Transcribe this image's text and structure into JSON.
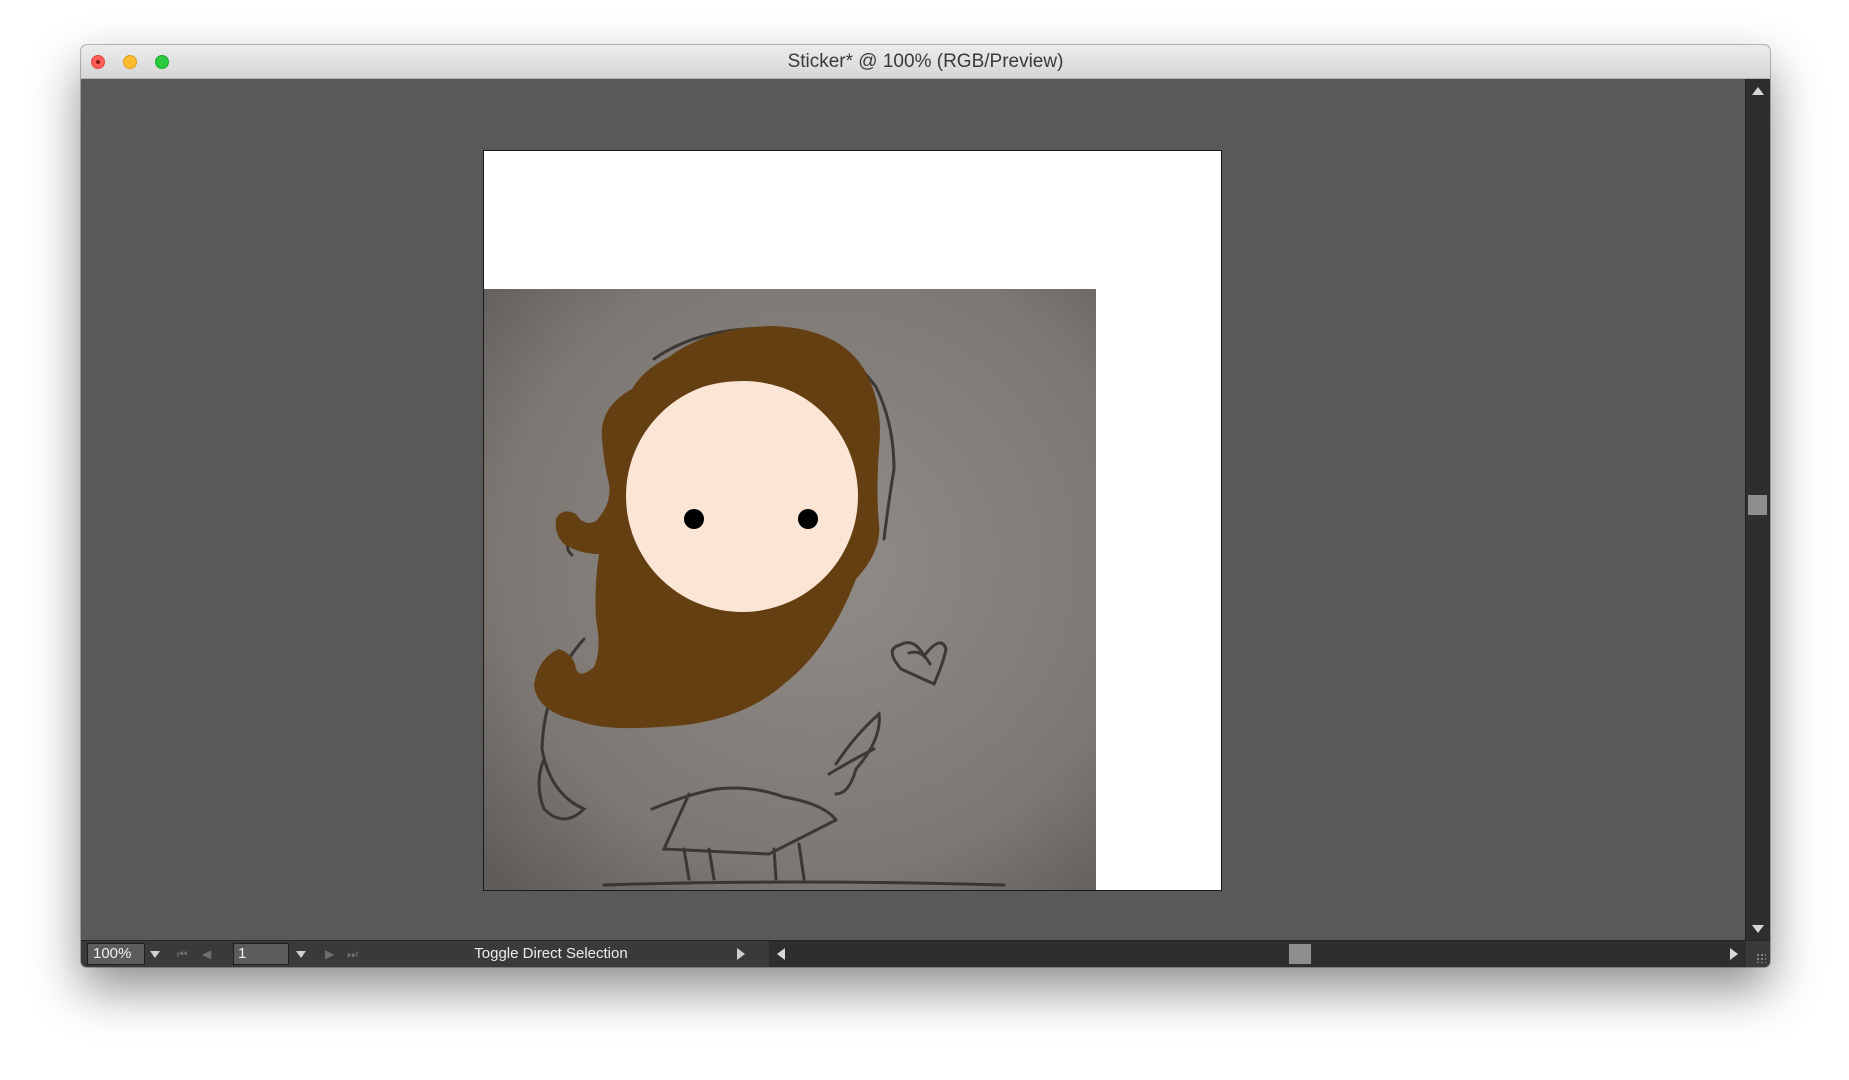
{
  "window": {
    "title": "Sticker* @ 100% (RGB/Preview)"
  },
  "statusbar": {
    "zoom": "100%",
    "page": "1",
    "status_text": "Toggle Direct Selection"
  },
  "icons": {
    "close": "close-icon",
    "minimize": "minimize-icon",
    "maximize": "maximize-icon",
    "first_page": "first-page-icon",
    "prev_page": "prev-page-icon",
    "next_page": "next-page-icon",
    "last_page": "last-page-icon"
  },
  "colors": {
    "hair": "#643f12",
    "face": "#fbe5d5",
    "eyes": "#000000",
    "pasteboard": "#595959",
    "artboard": "#ffffff",
    "photo_paper": "#7d7874"
  }
}
